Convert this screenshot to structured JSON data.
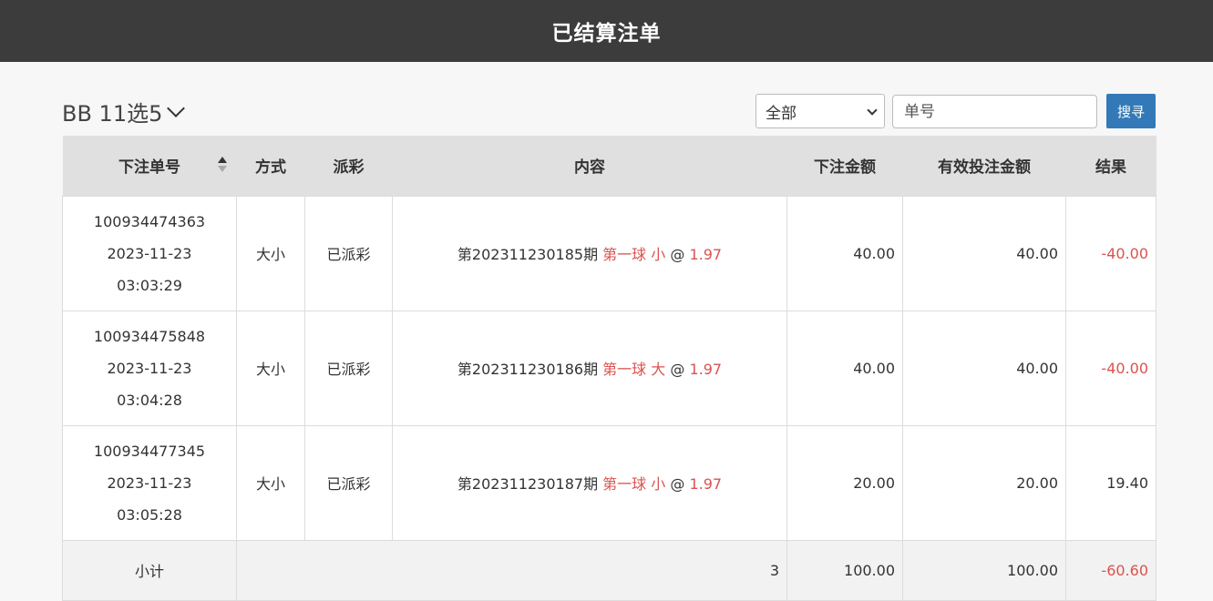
{
  "header": {
    "title": "已结算注单"
  },
  "toolbar": {
    "game_name": "BB 11选5",
    "filter_selected": "全部",
    "order_placeholder": "单号",
    "search_label": "搜寻"
  },
  "table": {
    "columns": [
      "下注单号",
      "方式",
      "派彩",
      "内容",
      "下注金额",
      "有效投注金额",
      "结果"
    ],
    "rows": [
      {
        "order_no": "100934474363",
        "date": "2023-11-23",
        "time": "03:03:29",
        "method": "大小",
        "payout": "已派彩",
        "content_prefix": "第202311230185期",
        "content_pick": "第一球 小",
        "content_at": "@",
        "content_odds": "1.97",
        "bet_amount": "40.00",
        "valid_amount": "40.00",
        "result": "-40.00"
      },
      {
        "order_no": "100934475848",
        "date": "2023-11-23",
        "time": "03:04:28",
        "method": "大小",
        "payout": "已派彩",
        "content_prefix": "第202311230186期",
        "content_pick": "第一球 大",
        "content_at": "@",
        "content_odds": "1.97",
        "bet_amount": "40.00",
        "valid_amount": "40.00",
        "result": "-40.00"
      },
      {
        "order_no": "100934477345",
        "date": "2023-11-23",
        "time": "03:05:28",
        "method": "大小",
        "payout": "已派彩",
        "content_prefix": "第202311230187期",
        "content_pick": "第一球 小",
        "content_at": "@",
        "content_odds": "1.97",
        "bet_amount": "20.00",
        "valid_amount": "20.00",
        "result": "19.40"
      }
    ],
    "subtotal": {
      "label": "小计",
      "count": "3",
      "bet_amount": "100.00",
      "valid_amount": "100.00",
      "result": "-60.60"
    }
  },
  "colors": {
    "header_bg": "#3c3c3c",
    "accent": "#3379b7",
    "negative": "#d9534f"
  }
}
